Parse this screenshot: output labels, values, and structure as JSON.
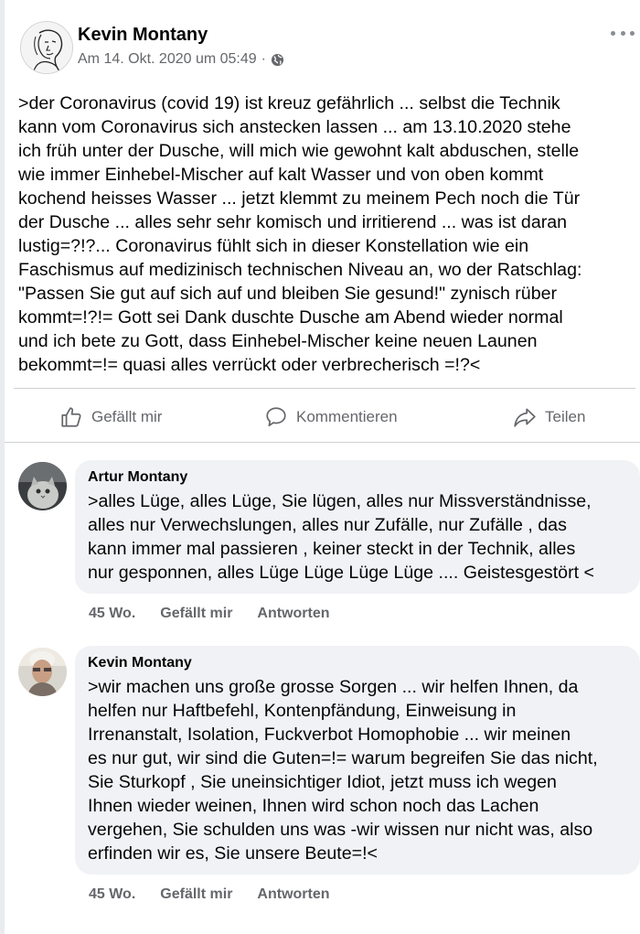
{
  "post": {
    "author": "Kevin Montany",
    "timestamp": "Am 14. Okt. 2020 um 05:49",
    "separator": "·",
    "privacy_icon": "globe-icon",
    "more_icon": "more-dots-icon",
    "text": ">der Coronavirus (covid 19) ist kreuz gefährlich ... selbst die Technik\nkann vom Coronavirus sich anstecken lassen ...  am 13.10.2020 stehe\nich früh unter der Dusche, will mich wie gewohnt kalt abduschen, stelle\nwie immer Einhebel-Mischer auf kalt Wasser und von oben kommt\nkochend heisses Wasser ... jetzt klemmt zu meinem Pech noch die Tür\nder Dusche ... alles sehr sehr  komisch und irritierend ... was ist daran\nlustig=?!?... Coronavirus fühlt sich in dieser Konstellation wie ein\nFaschismus auf medizinisch technischen Niveau an, wo der Ratschlag:\n\"Passen Sie gut auf sich auf und bleiben Sie gesund!\" zynisch rüber\nkommt=!?!= Gott sei Dank duschte  Dusche  am Abend wieder normal\nund ich bete zu Gott, dass Einhebel-Mischer keine neuen Launen\nbekommt=!= quasi alles verrückt oder verbrecherisch =!?<"
  },
  "actions": {
    "like_label": "Gefällt mir",
    "comment_label": "Kommentieren",
    "share_label": "Teilen"
  },
  "comments": [
    {
      "author": "Artur Montany",
      "text": ">alles Lüge, alles Lüge, Sie lügen, alles nur Missverständnisse,\nalles nur Verwechslungen,  alles nur Zufälle, nur Zufälle , das\nkann immer mal passieren , keiner steckt in der Technik, alles\nnur gesponnen, alles Lüge Lüge Lüge Lüge .... Geistesgestört <",
      "age": "45 Wo.",
      "like_label": "Gefällt mir",
      "reply_label": "Antworten"
    },
    {
      "author": "Kevin Montany",
      "text": ">wir machen uns große grosse Sorgen ... wir helfen Ihnen, da\nhelfen nur Haftbefehl, Kontenpfändung, Einweisung in\nIrrenanstalt, Isolation, Fuckverbot Homophobie  ... wir meinen\nes nur gut, wir sind die Guten=!= warum begreifen Sie das nicht,\nSie Sturkopf , Sie uneinsichtiger Idiot, jetzt muss ich wegen\nIhnen wieder weinen, Ihnen wird schon noch das Lachen\nvergehen, Sie schulden uns was -wir wissen nur nicht was, also\nerfinden wir es, Sie unsere Beute=!<",
      "age": "45 Wo.",
      "like_label": "Gefällt mir",
      "reply_label": "Antworten"
    }
  ],
  "colors": {
    "text": "#050505",
    "secondary": "#65676b",
    "bubble": "#f0f2f5",
    "divider": "#ced0d4"
  }
}
